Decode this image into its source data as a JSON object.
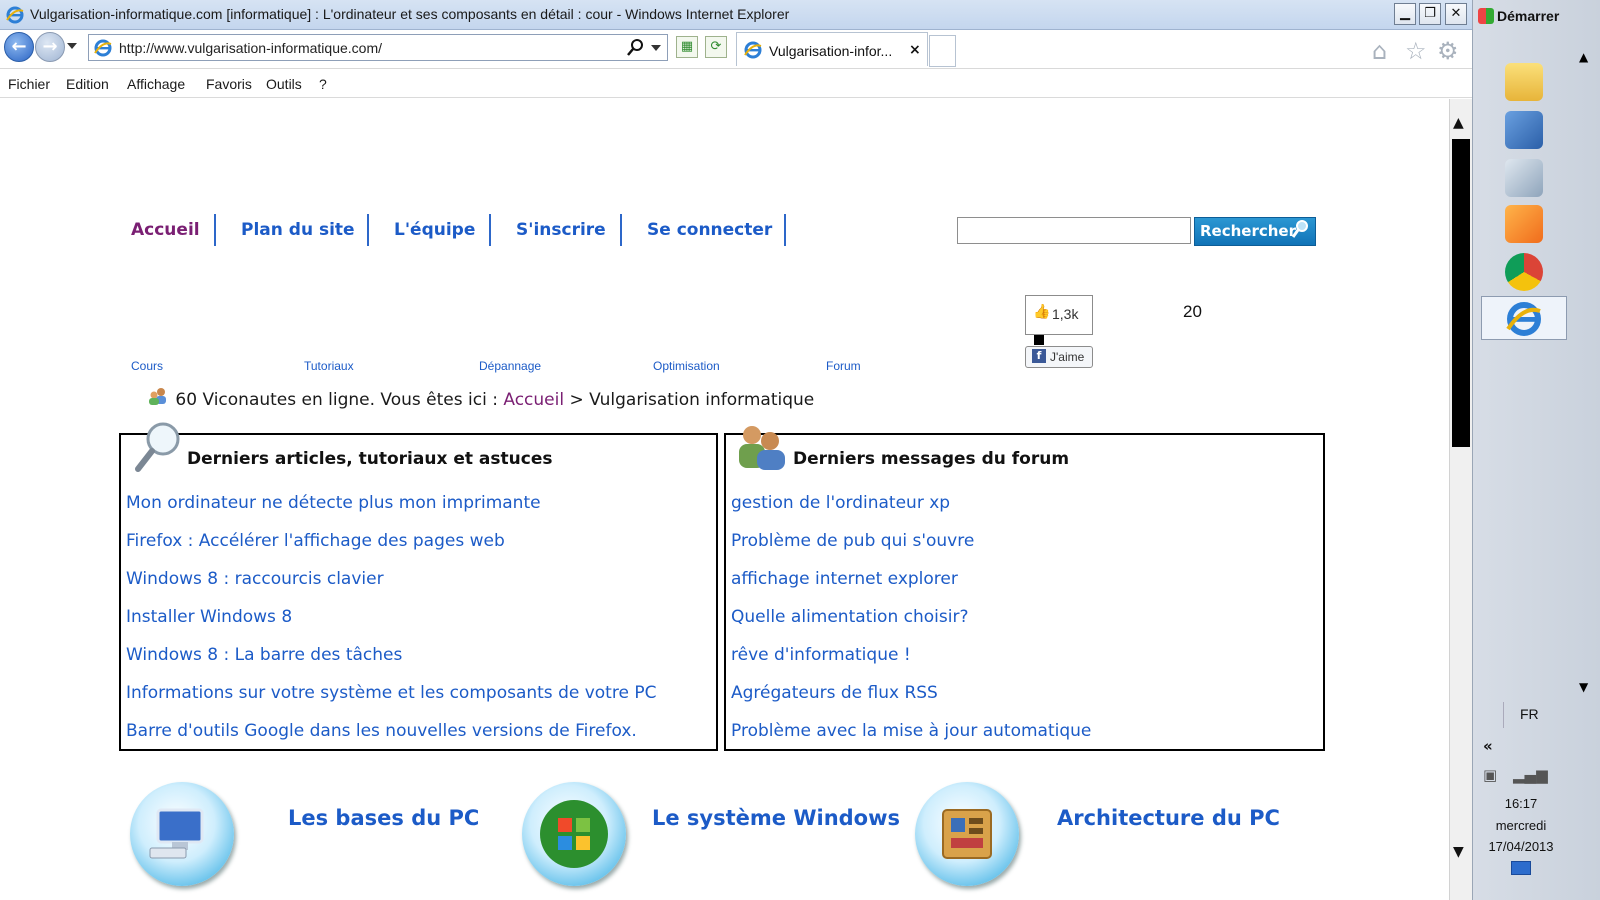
{
  "window": {
    "title": "Vulgarisation-informatique.com [informatique] : L'ordinateur et ses composants en détail : cour - Windows Internet Explorer",
    "minimize": "▁",
    "restore": "❐",
    "close": "✕"
  },
  "address_bar": {
    "url": "http://www.vulgarisation-informatique.com/",
    "tab_label": "Vulgarisation-infor...",
    "tab_close": "×"
  },
  "menu": [
    "Fichier",
    "Edition",
    "Affichage",
    "Favoris",
    "Outils",
    "?"
  ],
  "page": {
    "top_nav": [
      "Accueil",
      "Plan du site",
      "L'équipe",
      "S'inscrire",
      "Se connecter"
    ],
    "search_button": "Rechercher",
    "search_value": "",
    "fb_count": "1,3k",
    "fb_like": "J'aime",
    "counter": "20",
    "sub_nav": [
      "Cours",
      "Tutoriaux",
      "Dépannage",
      "Optimisation",
      "Forum"
    ],
    "breadcrumb": {
      "prefix": "60 Viconautes en ligne. Vous êtes ici : ",
      "home": "Accueil",
      "separator": " > ",
      "current": "Vulgarisation informatique"
    },
    "articles_box": {
      "title": "Derniers articles, tutoriaux et astuces",
      "items": [
        "Mon ordinateur ne détecte plus mon imprimante",
        "Firefox : Accélérer l'affichage des pages web",
        "Windows 8 : raccourcis clavier",
        "Installer Windows 8",
        "Windows 8 : La barre des tâches",
        "Informations sur votre système et les composants de votre PC",
        "Barre d'outils Google dans les nouvelles versions de Firefox."
      ]
    },
    "forum_box": {
      "title": "Derniers messages du forum",
      "items": [
        "gestion de l'ordinateur xp",
        "Problème de pub qui s'ouvre",
        "affichage internet explorer",
        "Quelle alimentation choisir?",
        "rêve d'informatique !",
        "Agrégateurs de flux RSS",
        "Problème avec la mise à jour automatique"
      ]
    },
    "categories": [
      "Les bases du PC",
      "Le système Windows",
      "Architecture du PC"
    ]
  },
  "taskbar": {
    "start": "Démarrer",
    "lang": "FR",
    "tray_chevron": "«",
    "time": "16:17",
    "day": "mercredi",
    "date": "17/04/2013"
  },
  "colors": {
    "link": "#1c5bc7",
    "visited": "#7a1f73",
    "search_button": "#1a86c8"
  }
}
